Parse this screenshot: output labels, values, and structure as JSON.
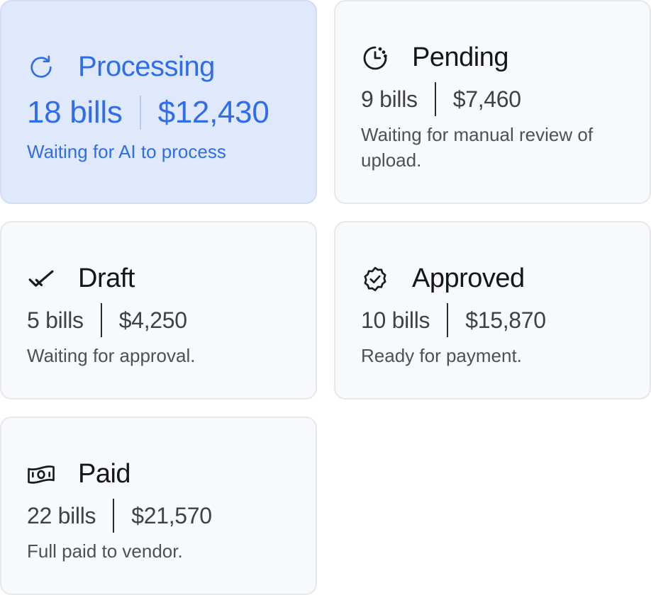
{
  "cards": [
    {
      "title": "Processing",
      "icon": "refresh-icon",
      "bills": "18 bills",
      "amount": "$12,430",
      "description": "Waiting for AI to process",
      "active": true,
      "accent_color": "#2f6ee8"
    },
    {
      "title": "Pending",
      "icon": "clock-pending-icon",
      "bills": "9 bills",
      "amount": "$7,460",
      "description": "Waiting for manual review of upload."
    },
    {
      "title": "Draft",
      "icon": "checkmark-icon",
      "bills": "5 bills",
      "amount": "$4,250",
      "description": "Waiting for approval."
    },
    {
      "title": "Approved",
      "icon": "badge-check-icon",
      "bills": "10 bills",
      "amount": "$15,870",
      "description": "Ready for payment."
    },
    {
      "title": "Paid",
      "icon": "banknote-icon",
      "bills": "22 bills",
      "amount": "$21,570",
      "description": "Full paid to vendor."
    }
  ]
}
